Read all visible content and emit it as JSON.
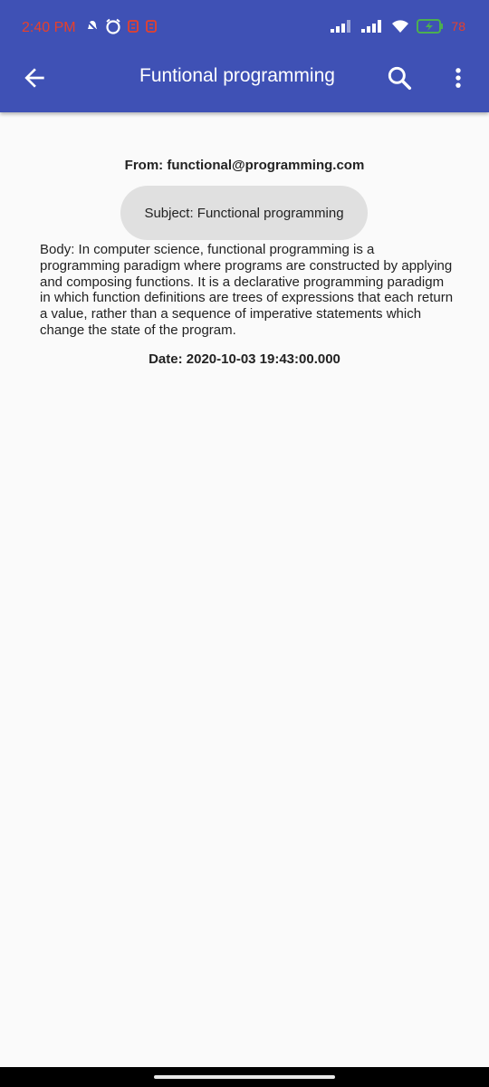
{
  "status_bar": {
    "time": "2:40 PM",
    "battery_percent": "78",
    "icons_left": [
      "mute-icon",
      "alarm-icon",
      "notification-icon",
      "notification-icon"
    ],
    "icons_right": [
      "signal-icon",
      "signal-icon",
      "wifi-icon",
      "battery-charging-icon"
    ]
  },
  "app_bar": {
    "title": "Funtional programming",
    "color": "#3f51b5",
    "icons": [
      "back-arrow-icon",
      "search-icon",
      "more-vert-icon"
    ]
  },
  "email": {
    "from": "From: functional@programming.com",
    "subject": "Subject: Functional programming",
    "body": "Body: In computer science, functional programming is a programming paradigm where programs are constructed by applying and composing functions. It is a declarative programming paradigm in which function definitions are trees of expressions that each return a value, rather than a sequence of imperative statements which change the state of the program.",
    "date": "Date: 2020-10-03 19:43:00.000"
  }
}
